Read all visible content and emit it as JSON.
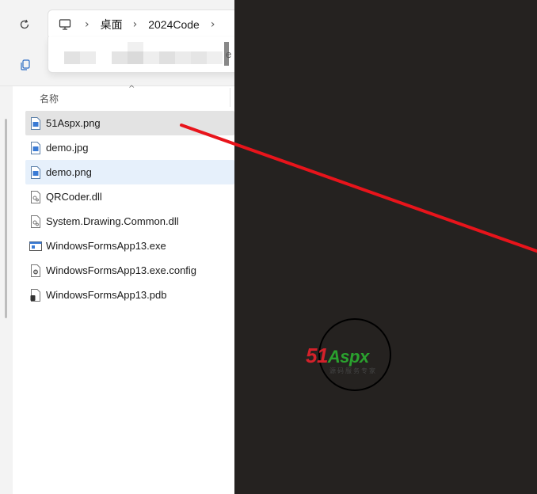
{
  "address_bar": {
    "breadcrumbs": [
      "桌面",
      "2024Code"
    ]
  },
  "history_dropdown": {
    "tail_text": "e"
  },
  "column_header": {
    "name_label": "名称"
  },
  "files": [
    {
      "name": "51Aspx.png",
      "icon": "image-file-icon",
      "state": "selected"
    },
    {
      "name": "demo.jpg",
      "icon": "image-file-icon",
      "state": "normal"
    },
    {
      "name": "demo.png",
      "icon": "image-file-icon",
      "state": "hover"
    },
    {
      "name": "QRCoder.dll",
      "icon": "dll-file-icon",
      "state": "normal"
    },
    {
      "name": "System.Drawing.Common.dll",
      "icon": "dll-file-icon",
      "state": "normal"
    },
    {
      "name": "WindowsFormsApp13.exe",
      "icon": "exe-file-icon",
      "state": "normal"
    },
    {
      "name": "WindowsFormsApp13.exe.config",
      "icon": "config-file-icon",
      "state": "normal"
    },
    {
      "name": "WindowsFormsApp13.pdb",
      "icon": "pdb-file-icon",
      "state": "normal"
    }
  ],
  "watermark": {
    "logo_red": "51",
    "logo_green": "Aspx",
    "subtitle": "源码服务专家"
  },
  "colors": {
    "preview_background": "#252220",
    "annotation_arrow": "#e8141b",
    "selected_row": "#e3e3e3",
    "hover_row": "#e6f0fb"
  }
}
